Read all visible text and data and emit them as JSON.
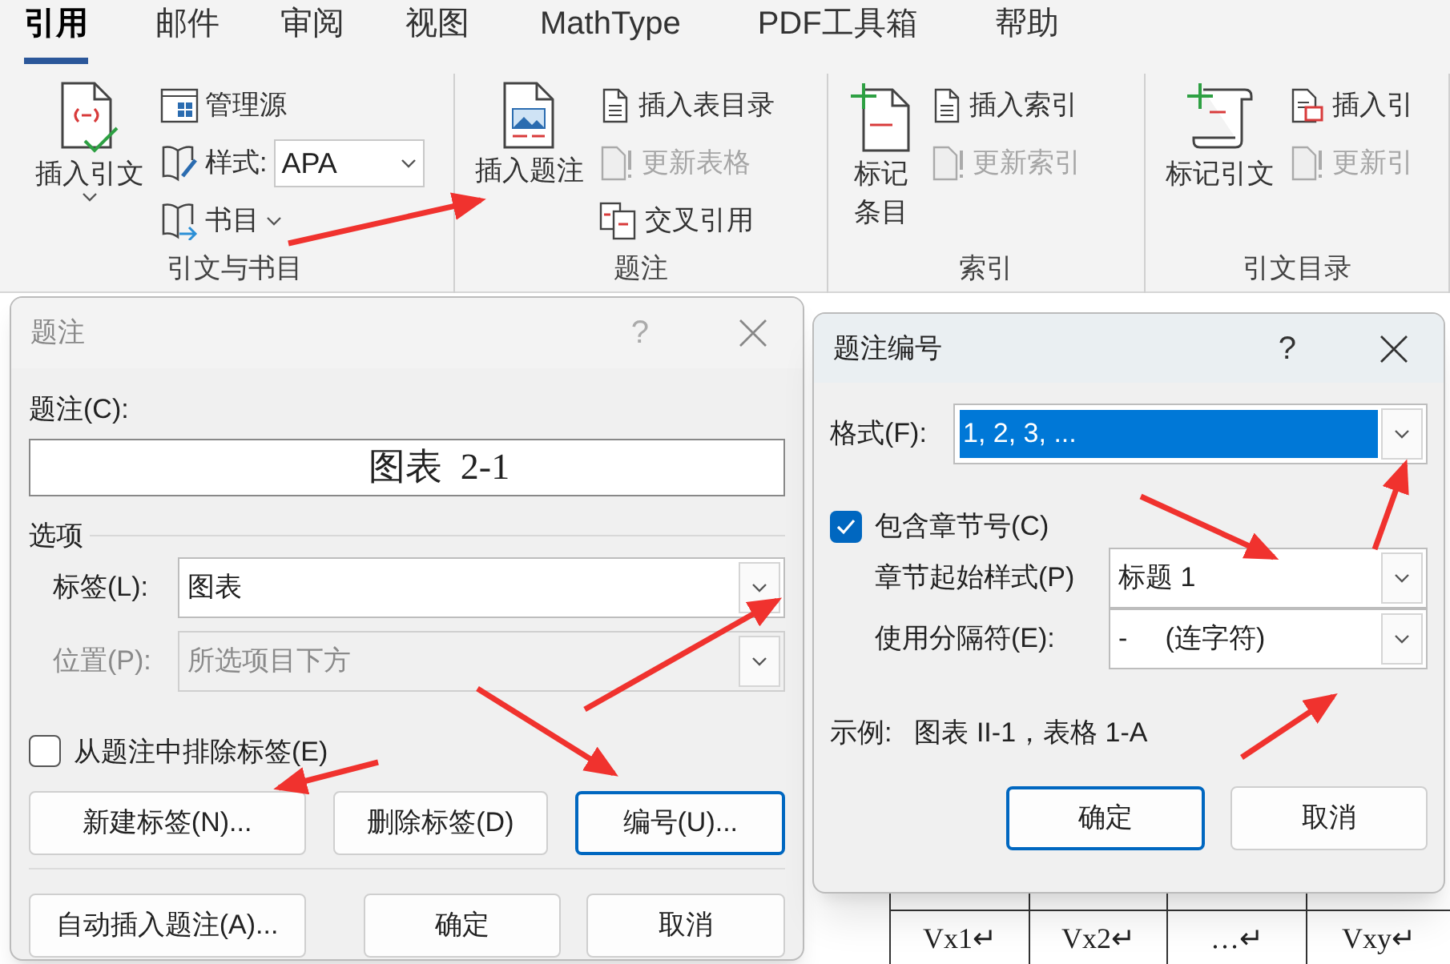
{
  "ribbon": {
    "tabs": [
      {
        "label": "引用",
        "selected": true
      },
      {
        "label": "邮件",
        "selected": false
      },
      {
        "label": "审阅",
        "selected": false
      },
      {
        "label": "视图",
        "selected": false
      },
      {
        "label": "MathType",
        "selected": false
      },
      {
        "label": "PDF工具箱",
        "selected": false
      },
      {
        "label": "帮助",
        "selected": false
      }
    ],
    "groups": [
      {
        "label": "引文与书目",
        "large": {
          "label_lines": [
            "插入引文"
          ],
          "menu": true
        },
        "items": [
          {
            "kind": "button",
            "label": "管理源",
            "disabled": false,
            "menu": false
          },
          {
            "kind": "style",
            "label": "样式:",
            "value": "APA"
          },
          {
            "kind": "button",
            "label": "书目",
            "disabled": false,
            "menu": true
          }
        ]
      },
      {
        "label": "题注",
        "large": {
          "label_lines": [
            "插入题注"
          ],
          "menu": false
        },
        "items": [
          {
            "kind": "button",
            "label": "插入表目录",
            "disabled": false,
            "menu": false
          },
          {
            "kind": "button",
            "label": "更新表格",
            "disabled": true,
            "menu": false
          },
          {
            "kind": "button",
            "label": "交叉引用",
            "disabled": false,
            "menu": false
          }
        ]
      },
      {
        "label": "索引",
        "large": {
          "label_lines": [
            "标记",
            "条目"
          ],
          "menu": false
        },
        "items": [
          {
            "kind": "button",
            "label": "插入索引",
            "disabled": false,
            "menu": false
          },
          {
            "kind": "button",
            "label": "更新索引",
            "disabled": true,
            "menu": false
          }
        ]
      },
      {
        "label": "引文目录",
        "large": {
          "label_lines": [
            "标记引文"
          ],
          "menu": false
        },
        "items": [
          {
            "kind": "button",
            "label": "插入引",
            "disabled": false,
            "menu": false
          },
          {
            "kind": "button",
            "label": "更新引",
            "disabled": true,
            "menu": false
          }
        ]
      }
    ]
  },
  "document_table": {
    "cells": [
      "Vx1↵",
      "Vx2↵",
      "…↵",
      "Vxy↵"
    ]
  },
  "caption_dialog": {
    "title": "题注",
    "help": "?",
    "caption_label": "题注(C):",
    "caption_value": "图表  2-1",
    "options_heading": "选项",
    "fields": [
      {
        "label": "标签(L):",
        "value": "图表",
        "disabled": false
      },
      {
        "label": "位置(P):",
        "value": "所选项目下方",
        "disabled": true
      }
    ],
    "exclude_label": {
      "label": "从题注中排除标签(E)",
      "checked": false
    },
    "label_buttons": [
      {
        "label": "新建标签(N)...",
        "default": false
      },
      {
        "label": "删除标签(D)",
        "default": false
      },
      {
        "label": "编号(U)...",
        "default": true
      }
    ],
    "footer_buttons": [
      {
        "label": "自动插入题注(A)...",
        "default": false
      },
      {
        "label": "确定",
        "default": false
      },
      {
        "label": "取消",
        "default": false
      }
    ]
  },
  "numbering_dialog": {
    "title": "题注编号",
    "help": "?",
    "format_label": "格式(F):",
    "format_value": "1, 2, 3, ...",
    "format_highlighted": true,
    "include_chapter": {
      "label": "包含章节号(C)",
      "checked": true
    },
    "fields": [
      {
        "label": "章节起始样式(P)",
        "value": "标题 1"
      },
      {
        "label": "使用分隔符(E):",
        "value": "-     (连字符)"
      }
    ],
    "example_label": "示例:",
    "example_value": "图表 II-1，表格 1-A",
    "buttons": [
      {
        "label": "确定",
        "default": true
      },
      {
        "label": "取消",
        "default": false
      }
    ]
  }
}
